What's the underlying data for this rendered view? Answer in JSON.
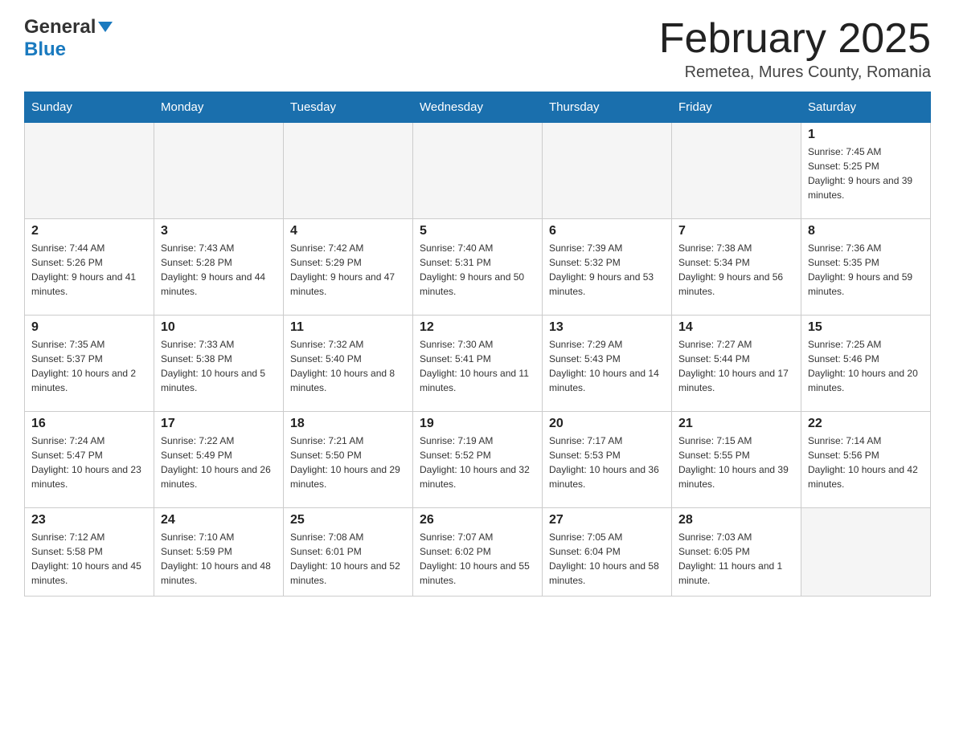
{
  "header": {
    "logo_general": "General",
    "logo_blue": "Blue",
    "title": "February 2025",
    "location": "Remetea, Mures County, Romania"
  },
  "weekdays": [
    "Sunday",
    "Monday",
    "Tuesday",
    "Wednesday",
    "Thursday",
    "Friday",
    "Saturday"
  ],
  "weeks": [
    [
      {
        "day": "",
        "info": ""
      },
      {
        "day": "",
        "info": ""
      },
      {
        "day": "",
        "info": ""
      },
      {
        "day": "",
        "info": ""
      },
      {
        "day": "",
        "info": ""
      },
      {
        "day": "",
        "info": ""
      },
      {
        "day": "1",
        "info": "Sunrise: 7:45 AM\nSunset: 5:25 PM\nDaylight: 9 hours and 39 minutes."
      }
    ],
    [
      {
        "day": "2",
        "info": "Sunrise: 7:44 AM\nSunset: 5:26 PM\nDaylight: 9 hours and 41 minutes."
      },
      {
        "day": "3",
        "info": "Sunrise: 7:43 AM\nSunset: 5:28 PM\nDaylight: 9 hours and 44 minutes."
      },
      {
        "day": "4",
        "info": "Sunrise: 7:42 AM\nSunset: 5:29 PM\nDaylight: 9 hours and 47 minutes."
      },
      {
        "day": "5",
        "info": "Sunrise: 7:40 AM\nSunset: 5:31 PM\nDaylight: 9 hours and 50 minutes."
      },
      {
        "day": "6",
        "info": "Sunrise: 7:39 AM\nSunset: 5:32 PM\nDaylight: 9 hours and 53 minutes."
      },
      {
        "day": "7",
        "info": "Sunrise: 7:38 AM\nSunset: 5:34 PM\nDaylight: 9 hours and 56 minutes."
      },
      {
        "day": "8",
        "info": "Sunrise: 7:36 AM\nSunset: 5:35 PM\nDaylight: 9 hours and 59 minutes."
      }
    ],
    [
      {
        "day": "9",
        "info": "Sunrise: 7:35 AM\nSunset: 5:37 PM\nDaylight: 10 hours and 2 minutes."
      },
      {
        "day": "10",
        "info": "Sunrise: 7:33 AM\nSunset: 5:38 PM\nDaylight: 10 hours and 5 minutes."
      },
      {
        "day": "11",
        "info": "Sunrise: 7:32 AM\nSunset: 5:40 PM\nDaylight: 10 hours and 8 minutes."
      },
      {
        "day": "12",
        "info": "Sunrise: 7:30 AM\nSunset: 5:41 PM\nDaylight: 10 hours and 11 minutes."
      },
      {
        "day": "13",
        "info": "Sunrise: 7:29 AM\nSunset: 5:43 PM\nDaylight: 10 hours and 14 minutes."
      },
      {
        "day": "14",
        "info": "Sunrise: 7:27 AM\nSunset: 5:44 PM\nDaylight: 10 hours and 17 minutes."
      },
      {
        "day": "15",
        "info": "Sunrise: 7:25 AM\nSunset: 5:46 PM\nDaylight: 10 hours and 20 minutes."
      }
    ],
    [
      {
        "day": "16",
        "info": "Sunrise: 7:24 AM\nSunset: 5:47 PM\nDaylight: 10 hours and 23 minutes."
      },
      {
        "day": "17",
        "info": "Sunrise: 7:22 AM\nSunset: 5:49 PM\nDaylight: 10 hours and 26 minutes."
      },
      {
        "day": "18",
        "info": "Sunrise: 7:21 AM\nSunset: 5:50 PM\nDaylight: 10 hours and 29 minutes."
      },
      {
        "day": "19",
        "info": "Sunrise: 7:19 AM\nSunset: 5:52 PM\nDaylight: 10 hours and 32 minutes."
      },
      {
        "day": "20",
        "info": "Sunrise: 7:17 AM\nSunset: 5:53 PM\nDaylight: 10 hours and 36 minutes."
      },
      {
        "day": "21",
        "info": "Sunrise: 7:15 AM\nSunset: 5:55 PM\nDaylight: 10 hours and 39 minutes."
      },
      {
        "day": "22",
        "info": "Sunrise: 7:14 AM\nSunset: 5:56 PM\nDaylight: 10 hours and 42 minutes."
      }
    ],
    [
      {
        "day": "23",
        "info": "Sunrise: 7:12 AM\nSunset: 5:58 PM\nDaylight: 10 hours and 45 minutes."
      },
      {
        "day": "24",
        "info": "Sunrise: 7:10 AM\nSunset: 5:59 PM\nDaylight: 10 hours and 48 minutes."
      },
      {
        "day": "25",
        "info": "Sunrise: 7:08 AM\nSunset: 6:01 PM\nDaylight: 10 hours and 52 minutes."
      },
      {
        "day": "26",
        "info": "Sunrise: 7:07 AM\nSunset: 6:02 PM\nDaylight: 10 hours and 55 minutes."
      },
      {
        "day": "27",
        "info": "Sunrise: 7:05 AM\nSunset: 6:04 PM\nDaylight: 10 hours and 58 minutes."
      },
      {
        "day": "28",
        "info": "Sunrise: 7:03 AM\nSunset: 6:05 PM\nDaylight: 11 hours and 1 minute."
      },
      {
        "day": "",
        "info": ""
      }
    ]
  ]
}
